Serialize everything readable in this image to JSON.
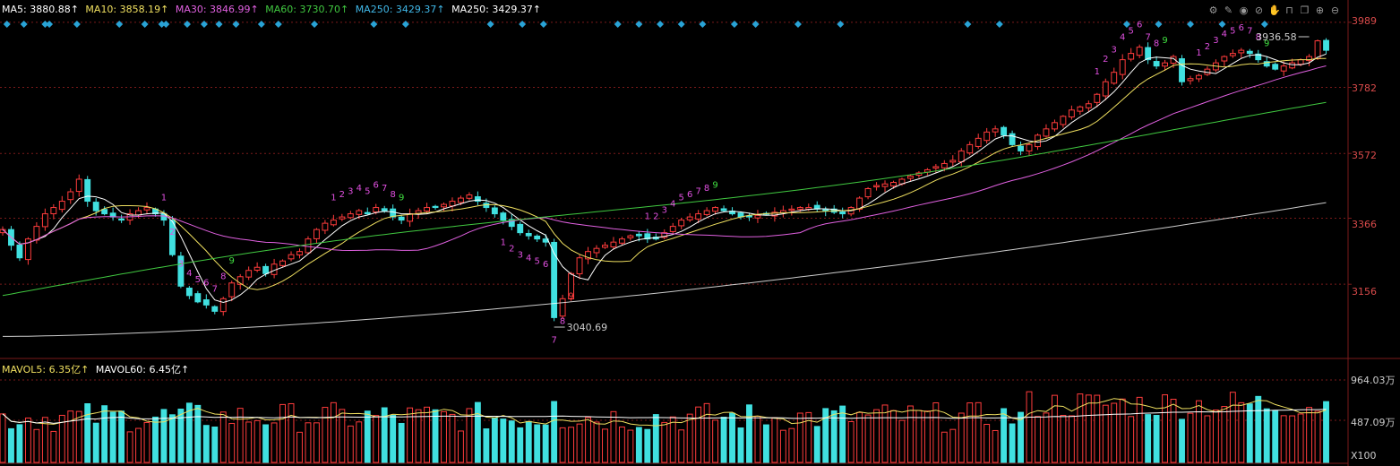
{
  "legend": [
    {
      "label": "MA5: 3880.88↑",
      "color": "#ffffff"
    },
    {
      "label": "MA10: 3858.19↑",
      "color": "#f0e060"
    },
    {
      "label": "MA30: 3846.99↑",
      "color": "#e060e0"
    },
    {
      "label": "MA60: 3730.70↑",
      "color": "#40c840"
    },
    {
      "label": "MA250: 3429.37↑",
      "color": "#40b8e8"
    },
    {
      "label": "MA250: 3429.37↑",
      "color": "#ffffff"
    }
  ],
  "volume_legend": [
    {
      "label": "MAVOL5: 6.35亿↑",
      "color": "#f0e060"
    },
    {
      "label": "MAVOL60: 6.45亿↑",
      "color": "#ffffff"
    }
  ],
  "toolbar_icons": [
    "gear-icon",
    "pen-icon",
    "eye-icon",
    "hide-icon",
    "hand-icon",
    "lock-icon",
    "copy-icon",
    "zoom-in-icon",
    "zoom-out-icon"
  ],
  "colors": {
    "up": "#ff3c3c",
    "down": "#40e0e0",
    "ma5": "#ffffff",
    "ma10": "#f0e060",
    "ma30": "#e060e0",
    "ma60": "#40c840",
    "ma250": "#ffffffcc",
    "grid": "#7a1a1a",
    "count_magenta": "#e050e0",
    "count_green": "#40e040",
    "count_red": "#ff4040"
  },
  "axis": {
    "price_ticks": [
      "3989",
      "3782",
      "3572",
      "3366",
      "3156"
    ],
    "volume_ticks": [
      "964.03万",
      "487.09万"
    ],
    "volume_unit": "X100"
  },
  "chart_data": {
    "type": "candlestick",
    "ylim": [
      2920,
      4020
    ],
    "y_ticks": [
      3989,
      3782,
      3572,
      3366,
      3156
    ],
    "high_annotation": "3936.58",
    "low_annotation": "3040.69",
    "close": [
      3330,
      3280,
      3240,
      3300,
      3340,
      3380,
      3400,
      3420,
      3450,
      3490,
      3420,
      3390,
      3380,
      3370,
      3360,
      3380,
      3390,
      3400,
      3380,
      3360,
      3250,
      3150,
      3120,
      3100,
      3090,
      3070,
      3110,
      3160,
      3180,
      3200,
      3210,
      3190,
      3220,
      3230,
      3250,
      3260,
      3300,
      3330,
      3350,
      3360,
      3370,
      3380,
      3390,
      3380,
      3400,
      3390,
      3370,
      3360,
      3380,
      3390,
      3400,
      3400,
      3410,
      3420,
      3430,
      3440,
      3420,
      3400,
      3380,
      3360,
      3340,
      3320,
      3310,
      3300,
      3290,
      3050,
      3110,
      3190,
      3240,
      3260,
      3270,
      3280,
      3290,
      3300,
      3310,
      3310,
      3300,
      3300,
      3320,
      3340,
      3360,
      3370,
      3380,
      3390,
      3400,
      3390,
      3380,
      3370,
      3370,
      3375,
      3380,
      3385,
      3390,
      3395,
      3400,
      3400,
      3395,
      3390,
      3385,
      3380,
      3400,
      3430,
      3460,
      3470,
      3475,
      3480,
      3490,
      3500,
      3510,
      3520,
      3530,
      3540,
      3550,
      3580,
      3600,
      3620,
      3640,
      3650,
      3630,
      3600,
      3580,
      3600,
      3630,
      3650,
      3670,
      3690,
      3710,
      3720,
      3730,
      3760,
      3800,
      3830,
      3870,
      3890,
      3910,
      3870,
      3850,
      3860,
      3880,
      3800,
      3810,
      3820,
      3840,
      3860,
      3880,
      3890,
      3900,
      3890,
      3870,
      3850,
      3840,
      3850,
      3860,
      3870,
      3880,
      3930,
      3900
    ]
  }
}
